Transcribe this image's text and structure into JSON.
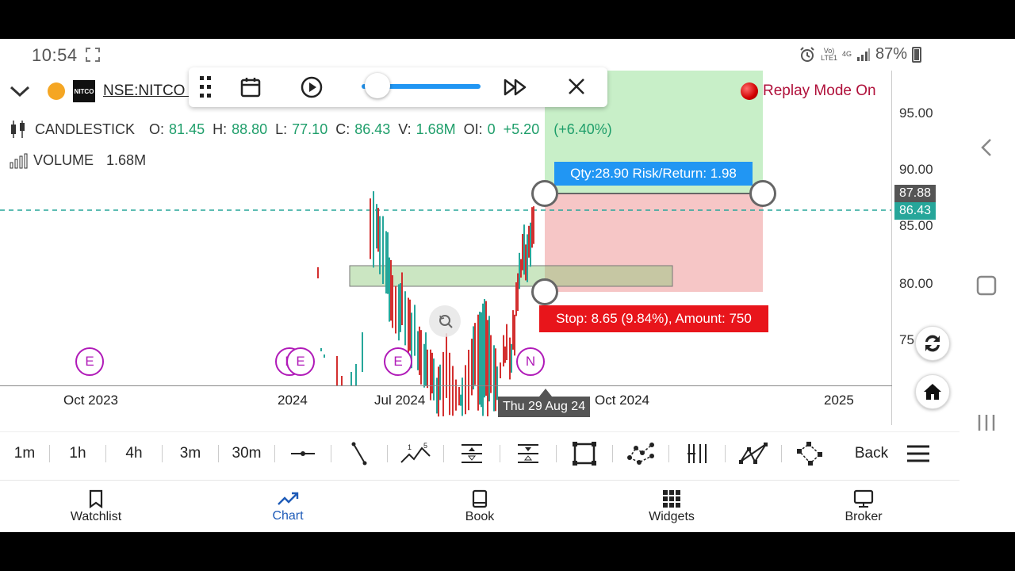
{
  "status_bar": {
    "time": "10:54",
    "signal_top": "Vo)",
    "signal_bottom": "LTE1",
    "network": "4G",
    "battery": "87%"
  },
  "header": {
    "symbol": "NSE:NITCO (",
    "logo_text": "NITCO",
    "replay_label": "Replay Mode On"
  },
  "legend": {
    "type_label": "CANDLESTICK",
    "o_label": "O:",
    "o_value": "81.45",
    "h_label": "H:",
    "h_value": "88.80",
    "l_label": "L:",
    "l_value": "77.10",
    "c_label": "C:",
    "c_value": "86.43",
    "v_label": "V:",
    "v_value": "1.68M",
    "oi_label": "OI:",
    "oi_value": "0",
    "change": "+5.20",
    "change_pct": "(+6.40%)",
    "volume_label": "VOLUME",
    "volume_value": "1.68M"
  },
  "price_axis": [
    "95.00",
    "90.00",
    "85.00",
    "80.00",
    "75"
  ],
  "time_axis": [
    "Oct 2023",
    "2024",
    "Jul 2024",
    "Oct 2024",
    "2025"
  ],
  "position": {
    "qty_text": "Qty:28.90 Risk/Return: 1.98",
    "stop_text": "Stop: 8.65 (9.84%), Amount: 750",
    "target_price": "87.88",
    "last_price": "86.43"
  },
  "crosshair_date": "Thu 29 Aug 24",
  "earnings_markers": [
    "E",
    "E",
    "E",
    "E",
    "N"
  ],
  "tools": {
    "intervals": [
      "1m",
      "1h",
      "4h",
      "3m",
      "30m"
    ],
    "back_label": "Back"
  },
  "bottom_nav": [
    {
      "label": "Watchlist",
      "icon": "bookmark-icon"
    },
    {
      "label": "Chart",
      "icon": "chart-trend-icon"
    },
    {
      "label": "Book",
      "icon": "book-icon"
    },
    {
      "label": "Widgets",
      "icon": "grid-icon"
    },
    {
      "label": "Broker",
      "icon": "monitor-icon"
    }
  ],
  "colors": {
    "up": "#26a69a",
    "down": "#d32f2f",
    "profit_zone": "#c8efc8",
    "loss_zone": "#f6c6c6",
    "accent_blue": "#2196f3",
    "stop_red": "#e8151b"
  }
}
